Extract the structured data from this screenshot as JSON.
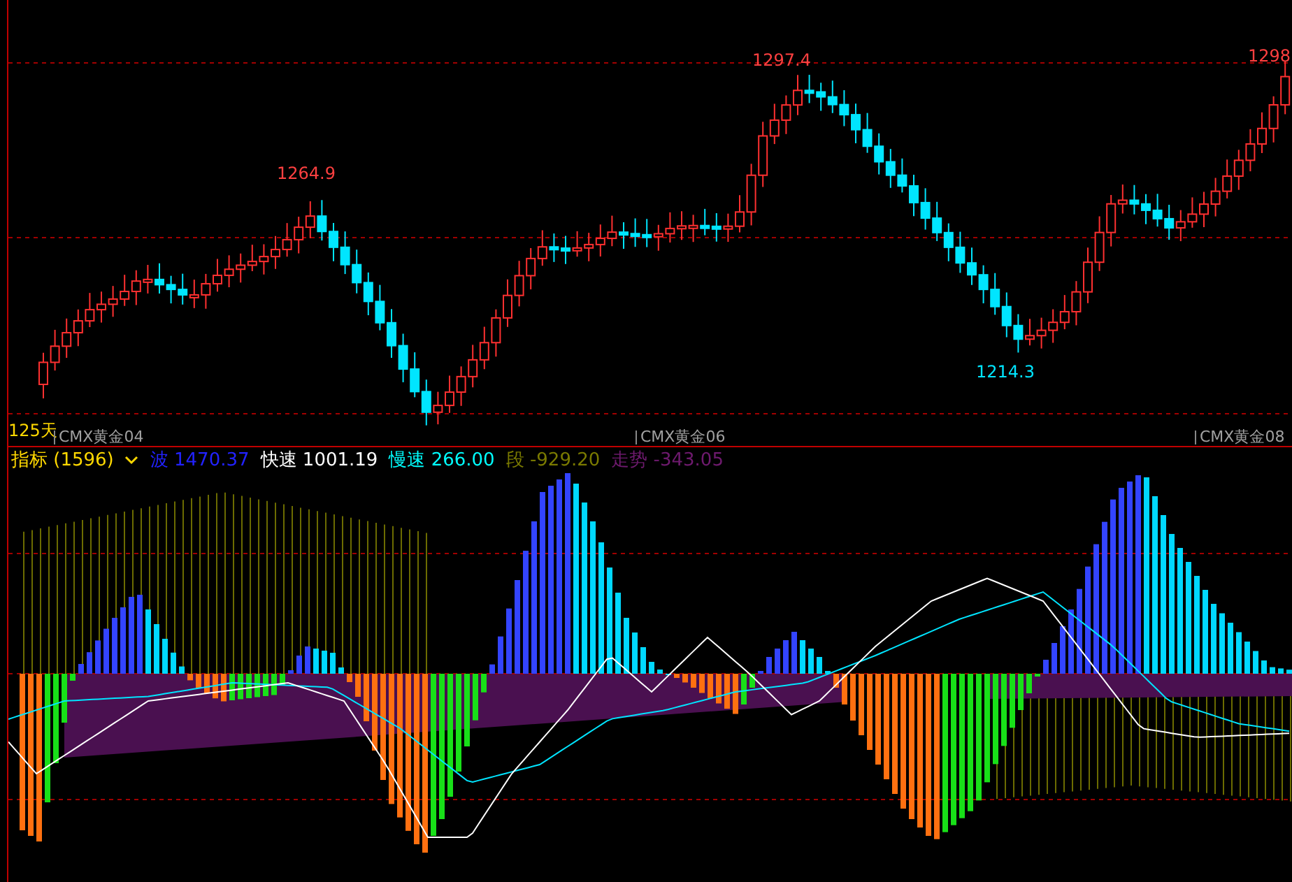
{
  "price_chart": {
    "period": "125天",
    "labels": [
      {
        "text": "1264.9",
        "kind": "high"
      },
      {
        "text": "1297.4",
        "kind": "high"
      },
      {
        "text": "1298",
        "kind": "high"
      },
      {
        "text": "1214.3",
        "kind": "low"
      }
    ],
    "contracts": [
      "CMX黄金04",
      "CMX黄金06",
      "CMX黄金08"
    ]
  },
  "indicator": {
    "name": "指标",
    "count": "(1596)",
    "series": [
      {
        "name": "波",
        "value": "1470.37",
        "color": "#2222ff"
      },
      {
        "name": "快速",
        "value": "1001.19",
        "color": "#ffffff"
      },
      {
        "name": "慢速",
        "value": "266.00",
        "color": "#00ffff"
      },
      {
        "name": "段",
        "value": "-929.20",
        "color": "#7a7a00"
      },
      {
        "name": "走势",
        "value": "-343.05",
        "color": "#6e1a6e"
      }
    ]
  }
}
